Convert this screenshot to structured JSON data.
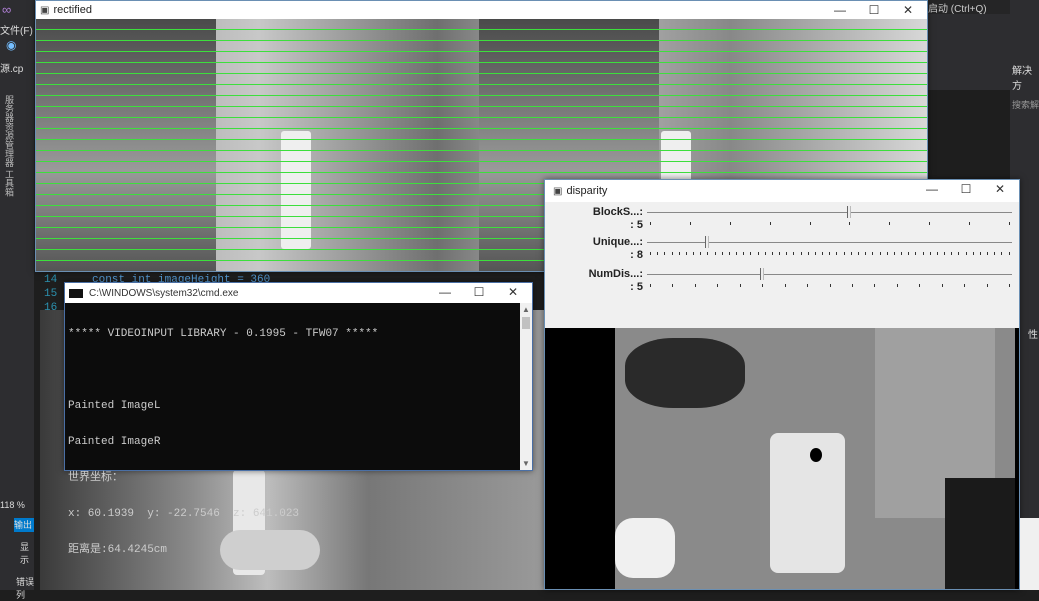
{
  "rectified": {
    "title": "rectified",
    "controls": [
      "—",
      "☐",
      "✕"
    ]
  },
  "disparity": {
    "title": "disparity",
    "controls": [
      "—",
      "☐",
      "✕"
    ],
    "trackbars": [
      {
        "label": "BlockS...:",
        "value_text": ": 5",
        "value": 5,
        "max": 9
      },
      {
        "label": "Unique...:",
        "value_text": ": 8",
        "value": 8,
        "max": 50
      },
      {
        "label": "NumDis...:",
        "value_text": ": 5",
        "value": 5,
        "max": 16
      }
    ]
  },
  "cmd": {
    "title": "C:\\WINDOWS\\system32\\cmd.exe",
    "controls": [
      "—",
      "☐",
      "✕"
    ],
    "lines": [
      "***** VIDEOINPUT LIBRARY - 0.1995 - TFW07 *****",
      "",
      "Painted ImageL",
      "Painted ImageR",
      "世界坐标：",
      "x: 60.1939  y: -22.7546  z: 641.023",
      "距离是:64.4245cm"
    ]
  },
  "vs": {
    "menu_file": "文件(F)",
    "tab_source": "源.cp",
    "quick_launch": "启动 (Ctrl+Q)",
    "solution": "解决方",
    "solution_search": "搜索解",
    "properties": "性",
    "zoom": "118 %",
    "output": "输出",
    "show": "显示",
    "errors": "错误列",
    "side_labels": "服务器资源管理器  工具箱",
    "code_line14_no": "14",
    "code_line14": "const int imageHeight = 360",
    "code_line15_no": "15",
    "code_line16_no": "16"
  }
}
